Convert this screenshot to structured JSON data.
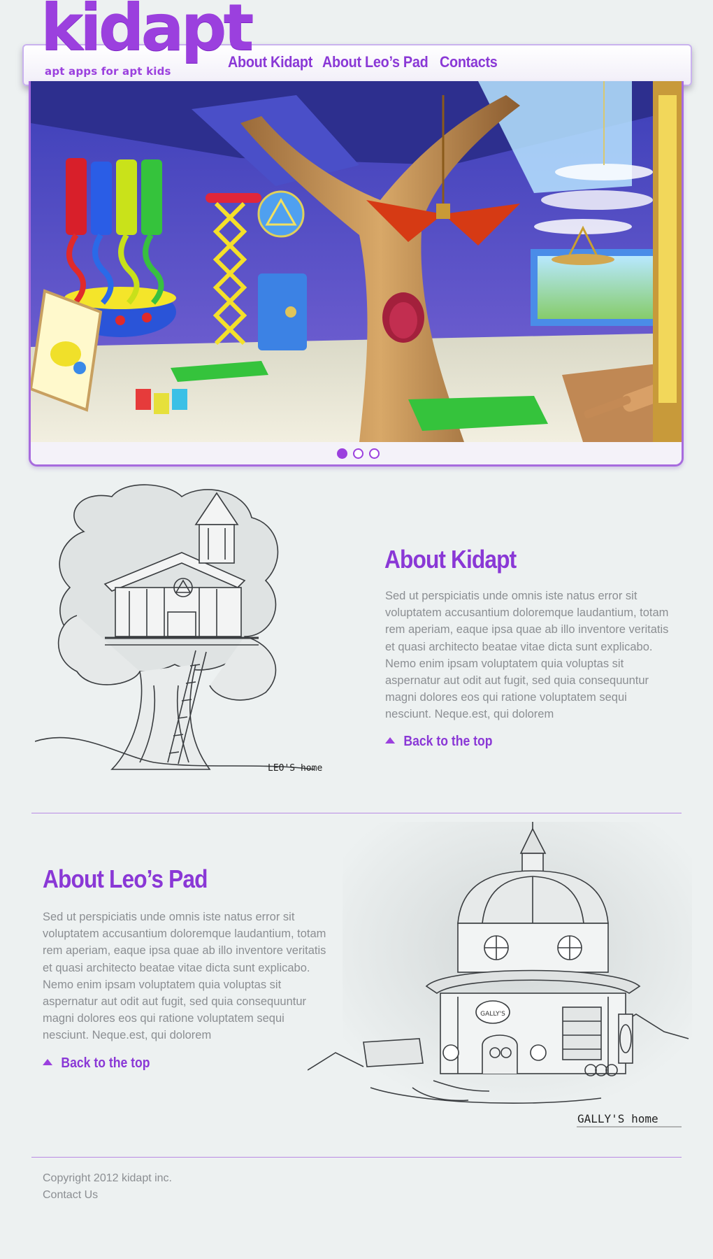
{
  "brand": {
    "name": "kidapt",
    "tagline": "apt apps for apt kids",
    "accent_color": "#9b40de"
  },
  "nav": {
    "items": [
      {
        "label": "About Kidapt"
      },
      {
        "label": "About Leo’s Pad"
      },
      {
        "label": "Contacts"
      }
    ]
  },
  "slider": {
    "slide_count": 3,
    "active_index": 0
  },
  "sections": [
    {
      "title": "About Kidapt",
      "body": "Sed ut perspiciatis unde omnis iste natus error sit voluptatem accusantium doloremque laudantium, totam rem aperiam, eaque ipsa quae ab illo inventore veritatis et quasi architecto beatae vitae dicta sunt explicabo. Nemo enim ipsam voluptatem quia voluptas sit aspernatur aut odit aut fugit, sed quia consequuntur magni dolores eos qui ratione voluptatem sequi nesciunt. Neque.est, qui dolorem",
      "back_to_top": "Back to the top",
      "illustration_caption": "LEO'S home"
    },
    {
      "title": "About Leo’s Pad",
      "body": "Sed ut perspiciatis unde omnis iste natus error sit voluptatem accusantium doloremque laudantium, totam rem aperiam, eaque ipsa quae ab illo inventore veritatis et quasi architecto beatae vitae dicta sunt explicabo. Nemo enim ipsam voluptatem quia voluptas sit aspernatur aut odit aut fugit, sed quia consequuntur magni dolores eos qui ratione voluptatem sequi nesciunt. Neque.est, qui dolorem",
      "back_to_top": "Back to the top",
      "illustration_caption": "GALLY'S home",
      "sign_text": "GALLY'S"
    }
  ],
  "footer": {
    "copyright": "Copyright 2012 kidapt inc.",
    "contact": "Contact Us"
  }
}
